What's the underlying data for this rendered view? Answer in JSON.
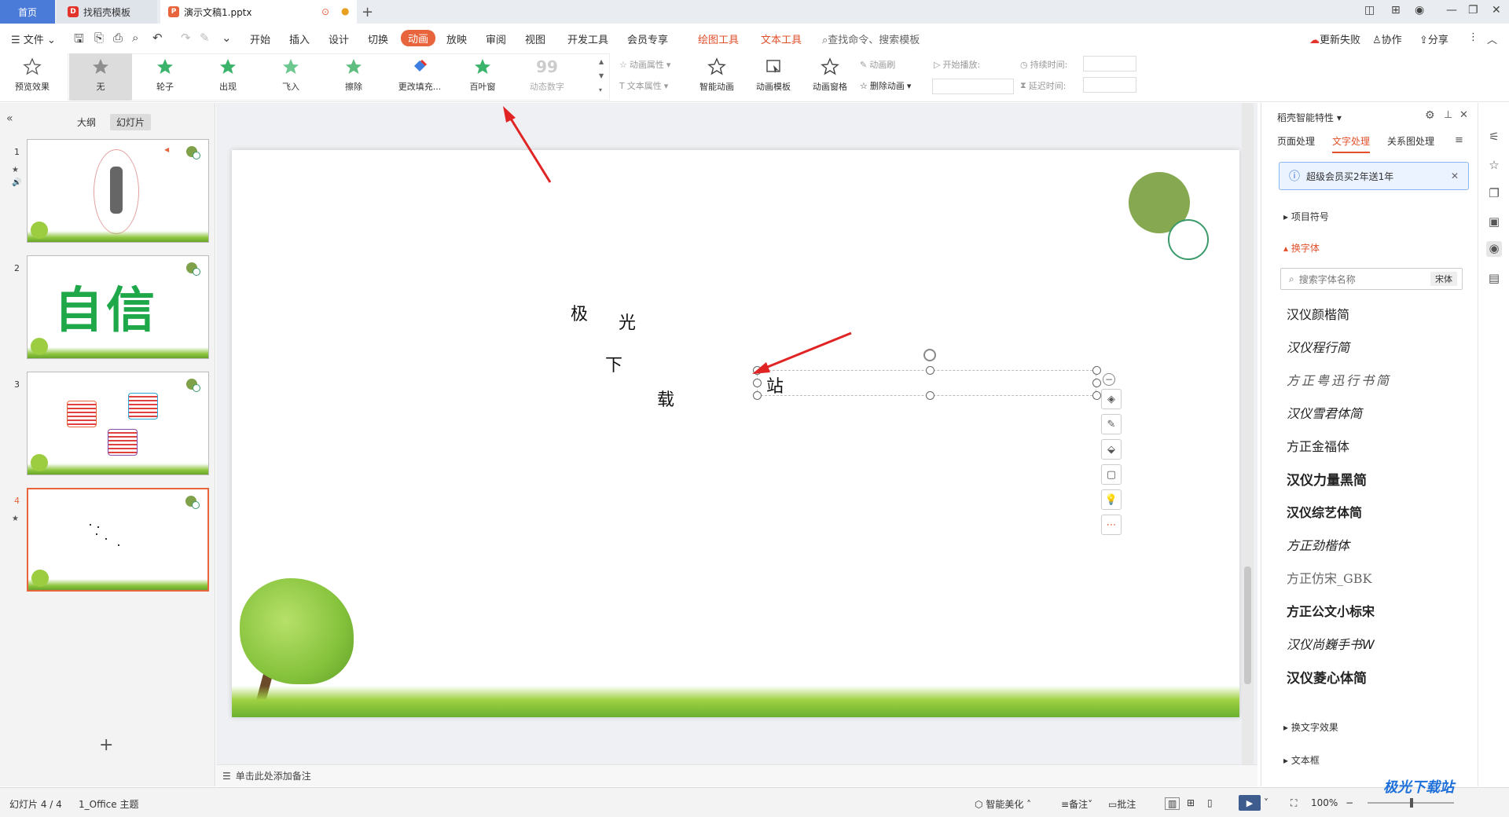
{
  "titlebar": {
    "tabs": [
      {
        "label": "首页"
      },
      {
        "label": "找稻壳模板"
      },
      {
        "label": "演示文稿1.pptx"
      }
    ]
  },
  "menu": {
    "file": "文件",
    "items": [
      "开始",
      "插入",
      "设计",
      "切换",
      "动画",
      "放映",
      "审阅",
      "视图",
      "开发工具",
      "会员专享"
    ],
    "context_tabs": [
      "绘图工具",
      "文本工具"
    ],
    "search": "查找命令、搜索模板",
    "right": [
      "更新失败",
      "协作",
      "分享"
    ]
  },
  "ribbon": {
    "preview": "预览效果",
    "effects": [
      "无",
      "轮子",
      "出现",
      "飞入",
      "擦除",
      "更改填充...",
      "百叶窗",
      "动态数字"
    ],
    "anim_props": "动画属性",
    "text_props": "文本属性",
    "smart_anim": "智能动画",
    "anim_template": "动画模板",
    "anim_pane": "动画窗格",
    "anim_brush": "动画刷",
    "delete_anim": "删除动画",
    "start_play": "开始播放:",
    "duration": "持续时间:",
    "delay": "延迟时间:"
  },
  "leftpanel": {
    "view_tabs": [
      "大纲",
      "幻灯片"
    ],
    "slides": [
      {
        "num": "1"
      },
      {
        "num": "2",
        "text": "自信"
      },
      {
        "num": "3"
      },
      {
        "num": "4"
      }
    ]
  },
  "slide": {
    "chars": [
      "极",
      "光",
      "下",
      "载"
    ],
    "textbox_text": "站"
  },
  "notes": {
    "placeholder": "单击此处添加备注"
  },
  "rightpane": {
    "title": "稻壳智能特性",
    "tabs": [
      "页面处理",
      "文字处理",
      "关系图处理"
    ],
    "promo": "超级会员买2年送1年",
    "sections": {
      "bullets": "项目符号",
      "font_swap": "换字体",
      "text_effect": "换文字效果",
      "textbox": "文本框"
    },
    "font_search_placeholder": "搜索字体名称",
    "current_font": "宋体",
    "fonts": [
      "汉仪颜楷简",
      "汉仪程行简",
      "方正粤迅行书简",
      "汉仪雪君体简",
      "方正金福体",
      "汉仪力量黑简",
      "汉仪综艺体简",
      "方正劲楷体",
      "方正仿宋_GBK",
      "方正公文小标宋",
      "汉仪尚巍手书W",
      "汉仪菱心体简"
    ]
  },
  "statusbar": {
    "slide_count": "幻灯片 4 / 4",
    "theme": "1_Office 主题",
    "beautify": "智能美化",
    "notes": "备注",
    "comment": "批注",
    "zoom": "100%"
  },
  "watermark": "极光下载站",
  "colors": {
    "accent": "#e8643c",
    "home_tab": "#4a7bd9",
    "context": "#e2502b"
  }
}
